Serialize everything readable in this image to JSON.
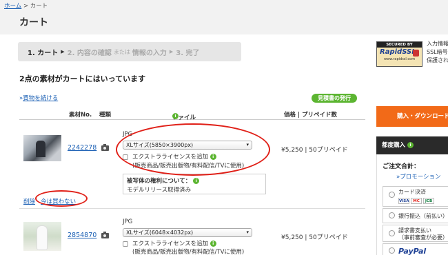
{
  "breadcrumb": {
    "home": "ホーム",
    "sep": ">",
    "current": "カート"
  },
  "page_title": "カート",
  "steps": {
    "step1": "1. カート",
    "step2": "2. 内容の確認",
    "step2_or": "または",
    "step2_alt": "情報の入力",
    "step3": "3. 完了",
    "arrow": "▶"
  },
  "ssl": {
    "top": "SECURED BY",
    "name": "RapidSSL",
    "url": "www.rapidssl.com",
    "text_lines": [
      "入力情報",
      "SSL暗号",
      "保護され"
    ]
  },
  "cart_count_text": "2点の素材がカートにはいっています",
  "continue_link": {
    "prefix": "»",
    "label": "買物を続ける"
  },
  "quote_button": "見積書の発行",
  "table": {
    "headers": {
      "material_no": "素材No.",
      "type": "種類",
      "file": "ファイル",
      "price": "価格 | プリペイド数"
    }
  },
  "items": [
    {
      "material_no": "2242278",
      "format": "JPG",
      "size": "XLサイズ(5850×3900px)",
      "extended_license": "エクストラライセンスを追加",
      "extended_license_note": "(販売商品/販売出版物/有料配信/TVに使用)",
      "rights_title": "被写体の権利について：",
      "rights_value": "モデルリリース取得済み",
      "price": "¥5,250 | 50プリペイド",
      "delete": "削除",
      "not_now": "今は買わない"
    },
    {
      "material_no": "2854870",
      "format": "JPG",
      "size": "XLサイズ(6048×4032px)",
      "extended_license": "エクストラライセンスを追加",
      "extended_license_note": "(販売商品/販売出版物/有料配信/TVに使用)",
      "price": "¥5,250 | 50プリペイド"
    }
  ],
  "sidebar": {
    "orange_button": "購入・ダウンロード",
    "section_title": "都度購入",
    "total_label": "ご注文合計：",
    "promo": "»プロモーション",
    "payment_options": [
      {
        "label": "カード決済",
        "cards": [
          "VISA",
          "MC",
          "JCB"
        ]
      },
      {
        "label": "銀行振込（前払い）"
      },
      {
        "label": "請求書支払い",
        "sub": "（事前審査が必要）"
      },
      {
        "label": "PayPal"
      }
    ]
  },
  "colors": {
    "accent_orange": "#f26a18",
    "info_green": "#5cb531",
    "annotation_red": "#e02018",
    "link_blue": "#1a5fb4"
  }
}
